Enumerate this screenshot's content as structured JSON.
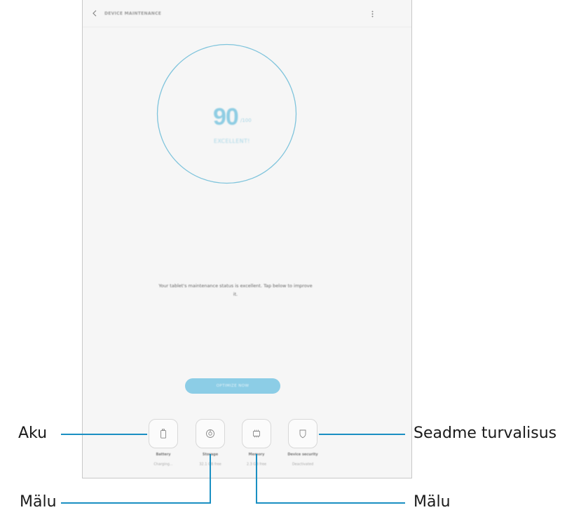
{
  "app": {
    "title": "DEVICE MAINTENANCE"
  },
  "score": {
    "value": "90",
    "max": "/100",
    "label": "EXCELLENT!",
    "ring_color": "#7fc4dc"
  },
  "status_message": {
    "line1": "Your tablet's maintenance status is excellent. Tap below to improve",
    "line2": "it."
  },
  "optimize_button": {
    "label": "OPTIMIZE NOW",
    "color": "#8ccde6"
  },
  "tiles": [
    {
      "icon": "battery-icon",
      "label": "Battery",
      "status": "Charging..."
    },
    {
      "icon": "storage-icon",
      "label": "Storage",
      "status": "32.1 GB free"
    },
    {
      "icon": "memory-icon",
      "label": "Memory",
      "status": "2.3 GB free"
    },
    {
      "icon": "shield-icon",
      "label": "Device security",
      "status": "Deactivated"
    }
  ],
  "callouts": {
    "battery": "Aku",
    "security": "Seadme turvalisus",
    "storage": "Mälu",
    "memory": "Mälu"
  }
}
